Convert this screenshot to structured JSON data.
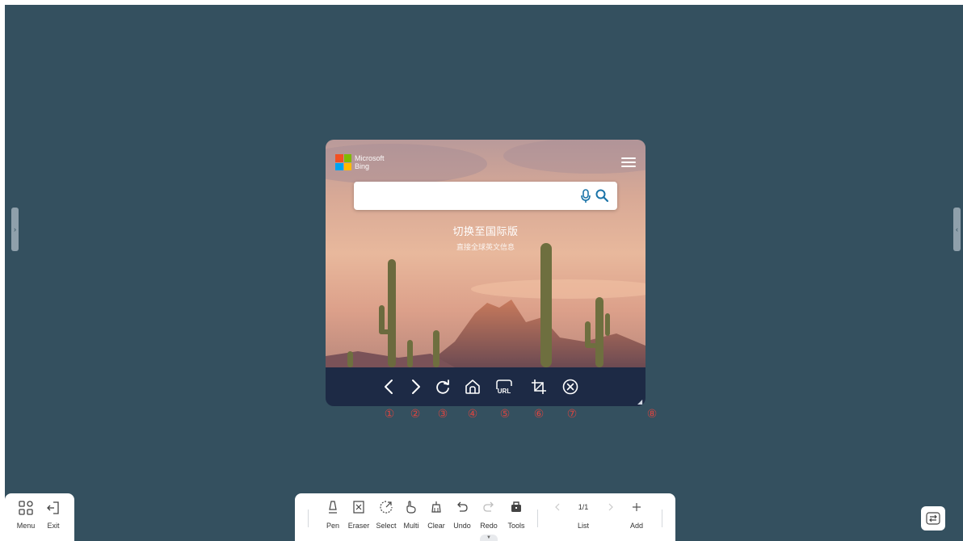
{
  "browser": {
    "logo_line1": "Microsoft",
    "logo_line2": "Bing",
    "search_value": "",
    "switch_title": "切换至国际版",
    "switch_subtitle": "直接全球英文信息"
  },
  "browser_toolbar": {
    "buttons": [
      "back",
      "forward",
      "refresh",
      "home",
      "url",
      "crop",
      "close"
    ],
    "url_label": "URL"
  },
  "callouts": [
    "①",
    "②",
    "③",
    "④",
    "⑤",
    "⑥",
    "⑦",
    "⑧"
  ],
  "left_panel": {
    "menu_label": "Menu",
    "exit_label": "Exit"
  },
  "toolbar": {
    "pen_label": "Pen",
    "eraser_label": "Eraser",
    "select_label": "Select",
    "multi_label": "Multi",
    "clear_label": "Clear",
    "undo_label": "Undo",
    "redo_label": "Redo",
    "tools_label": "Tools",
    "page_indicator": "1/1",
    "list_label": "List",
    "add_label": "Add"
  },
  "colors": {
    "canvas_bg": "#34505f",
    "browser_toolbar_bg": "#1d2a45",
    "callout_red": "#d64541"
  }
}
